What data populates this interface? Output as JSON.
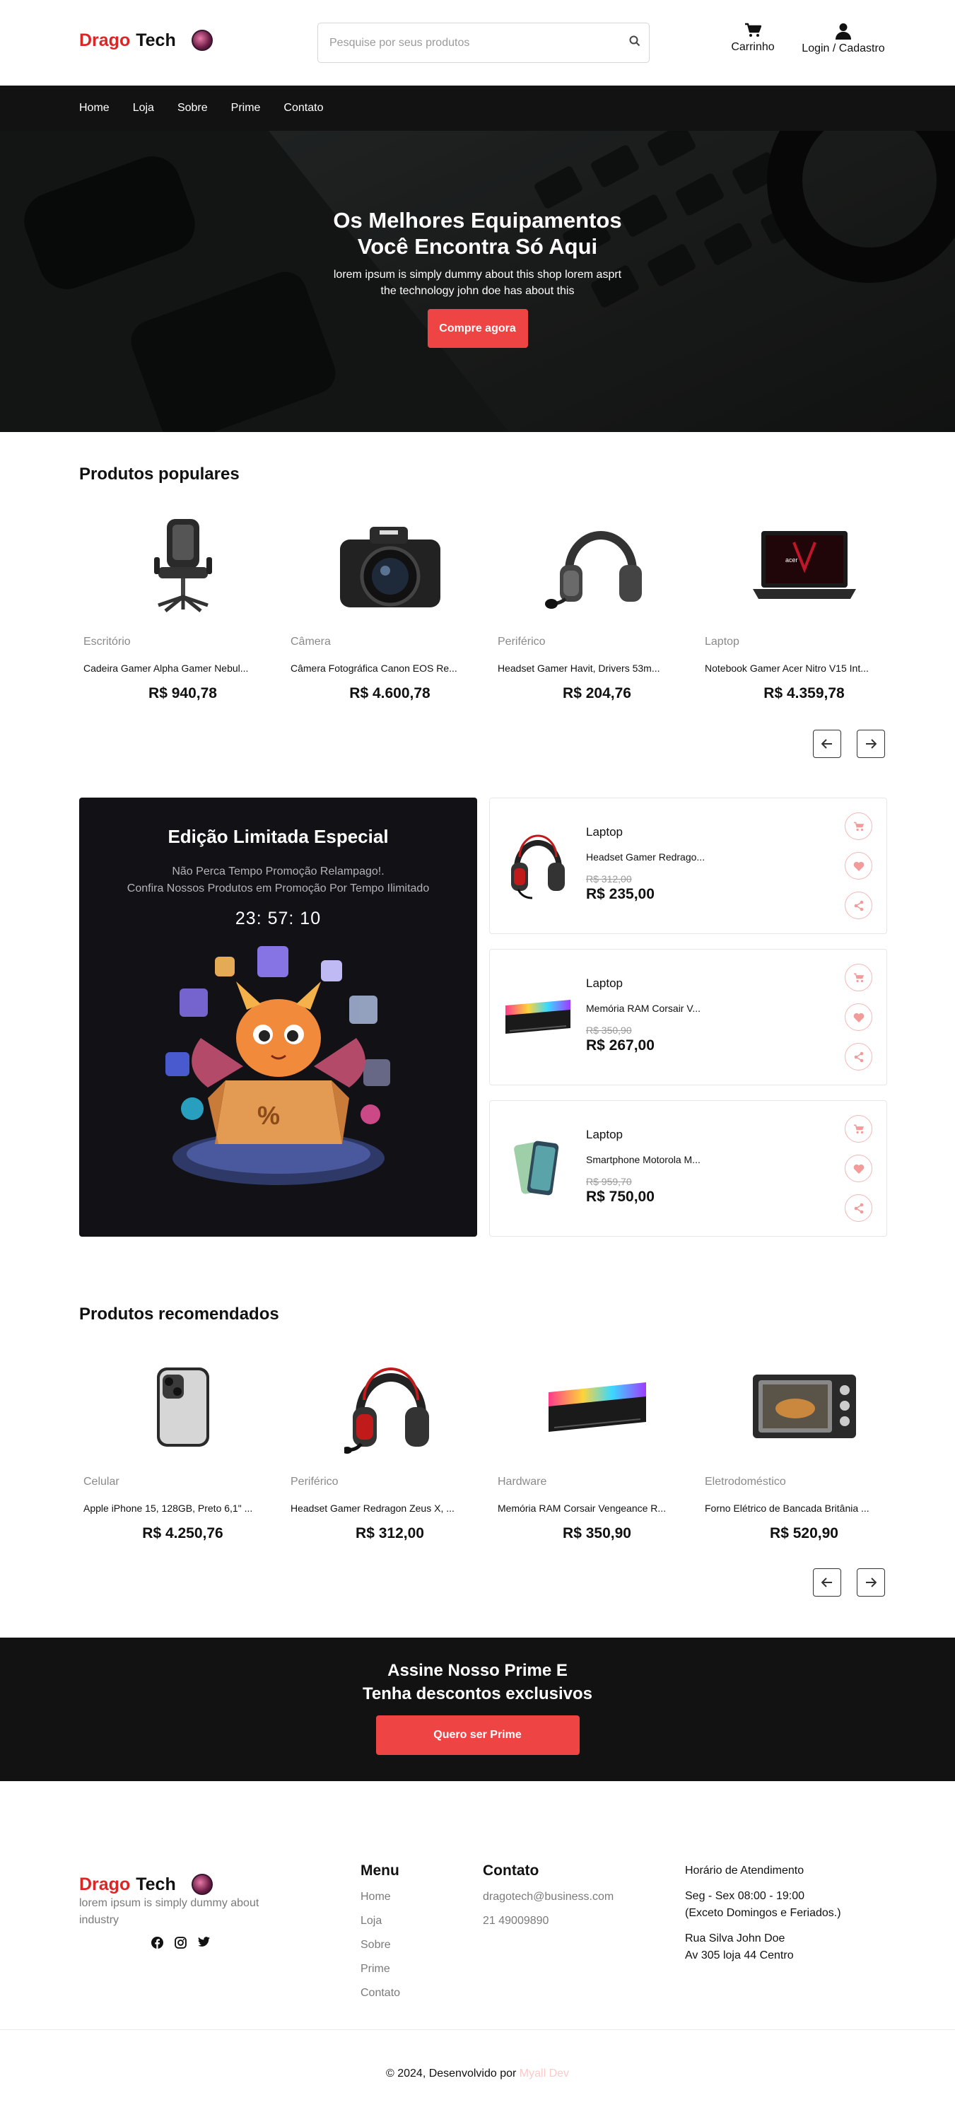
{
  "brand": {
    "part1": "Drago",
    "part2": "Tech"
  },
  "header": {
    "search_placeholder": "Pesquise por seus produtos",
    "cart_label": "Carrinho",
    "login_label": "Login / Cadastro"
  },
  "nav": {
    "items": [
      "Home",
      "Loja",
      "Sobre",
      "Prime",
      "Contato"
    ]
  },
  "hero": {
    "title_line1": "Os Melhores Equipamentos",
    "title_line2": "Você Encontra Só Aqui",
    "text_line1": "lorem ipsum is simply dummy about this shop lorem asprt",
    "text_line2": "the technology john doe has about this",
    "cta": "Compre agora"
  },
  "popular": {
    "title": "Produtos populares",
    "products": [
      {
        "category": "Escritório",
        "name": "Cadeira Gamer Alpha Gamer Nebul...",
        "price": "R$ 940,78",
        "icon": "chair"
      },
      {
        "category": "Câmera",
        "name": "Câmera Fotográfica Canon EOS Re...",
        "price": "R$ 4.600,78",
        "icon": "camera"
      },
      {
        "category": "Periférico",
        "name": "Headset Gamer Havit, Drivers 53m...",
        "price": "R$ 204,76",
        "icon": "headset"
      },
      {
        "category": "Laptop",
        "name": "Notebook Gamer Acer Nitro V15 Int...",
        "price": "R$ 4.359,78",
        "icon": "laptop"
      }
    ]
  },
  "promo": {
    "title": "Edição Limitada Especial",
    "text_line1": "Não Perca Tempo Promoção Relampago!.",
    "text_line2": "Confira Nossos Produtos em Promoção Por Tempo Ilimitado",
    "timer": "23: 57: 10"
  },
  "flash_products": [
    {
      "category": "Laptop",
      "name": "Headset Gamer Redrago...",
      "old_price": "R$ 312,00",
      "price": "R$ 235,00",
      "icon": "headset-red"
    },
    {
      "category": "Laptop",
      "name": "Memória RAM Corsair V...",
      "old_price": "R$ 350,90",
      "price": "R$ 267,00",
      "icon": "ram"
    },
    {
      "category": "Laptop",
      "name": "Smartphone Motorola M...",
      "old_price": "R$ 959,70",
      "price": "R$ 750,00",
      "icon": "phone-green"
    }
  ],
  "recommended": {
    "title": "Produtos recomendados",
    "products": [
      {
        "category": "Celular",
        "name": "Apple iPhone 15, 128GB, Preto 6,1\" ...",
        "price": "R$ 4.250,76",
        "icon": "iphone"
      },
      {
        "category": "Periférico",
        "name": "Headset Gamer Redragon Zeus X, ...",
        "price": "R$ 312,00",
        "icon": "headset-red"
      },
      {
        "category": "Hardware",
        "name": "Memória RAM Corsair Vengeance R...",
        "price": "R$ 350,90",
        "icon": "ram"
      },
      {
        "category": "Eletrodoméstico",
        "name": "Forno Elétrico de Bancada Britânia ...",
        "price": "R$ 520,90",
        "icon": "oven"
      }
    ]
  },
  "prime": {
    "line1": "Assine Nosso Prime E",
    "line2": "Tenha descontos exclusivos",
    "cta": "Quero ser Prime"
  },
  "footer": {
    "about": "lorem ipsum is simply dummy about industry",
    "menu_title": "Menu",
    "menu": [
      "Home",
      "Loja",
      "Sobre",
      "Prime",
      "Contato"
    ],
    "contact_title": "Contato",
    "email": "dragotech@business.com",
    "phone": "21 49009890",
    "hours_title": "Horário de Atendimento",
    "hours_line1": "Seg - Sex 08:00 - 19:00",
    "hours_line2": "(Exceto Domingos e Feriados.)",
    "address_line1": "Rua Silva John Doe",
    "address_line2": "Av 305 loja 44 Centro",
    "copyright": "© 2024, Desenvolvido por",
    "developer": "Myall Dev"
  },
  "colors": {
    "accent": "#ef4444",
    "brand_red": "#dc2626",
    "dark": "#121212"
  }
}
